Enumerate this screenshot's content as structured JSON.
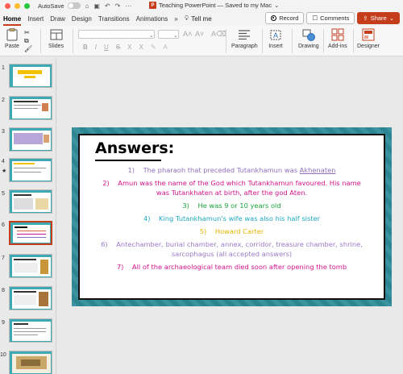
{
  "window": {
    "autosave_label": "AutoSave",
    "doc_title": "Teaching PowerPoint — Saved to my Mac",
    "doc_title_chevron": "⌄"
  },
  "tabs": [
    "Home",
    "Insert",
    "Draw",
    "Design",
    "Transitions",
    "Animations"
  ],
  "tabs_more": "»",
  "tell_me": "Tell me",
  "buttons": {
    "record": "Record",
    "comments": "Comments",
    "share": "Share"
  },
  "ribbon": {
    "paste": "Paste",
    "slides": "Slides",
    "format_buttons": [
      "B",
      "I",
      "U",
      "S",
      "X",
      "X"
    ],
    "paragraph": "Paragraph",
    "insert": "Insert",
    "drawing": "Drawing",
    "addins": "Add-ins",
    "designer": "Designer"
  },
  "thumbnails": {
    "numbers": [
      "1",
      "2",
      "3",
      "4",
      "5",
      "6",
      "7",
      "8",
      "9",
      "10"
    ],
    "star": "★",
    "selected_index": 6
  },
  "slide": {
    "title": "Answers:",
    "lines": [
      {
        "num": "1)",
        "text": "The pharaoh that preceded Tutankhamun was",
        "link": "Akhenaten"
      },
      {
        "num": "2)",
        "text": "Amun was the name of the God which Tutankhamun favoured. His name"
      },
      {
        "text": "was Tutankhaten at birth, after the god Aten."
      },
      {
        "num": "3)",
        "text": "He was 9 or 10 years old"
      },
      {
        "num": "4)",
        "text": "King Tutankhamun's wife was also his half sister"
      },
      {
        "num": "5)",
        "text": "Howard Carter"
      },
      {
        "num": "6)",
        "text": "Antechamber, burial chamber, annex, corridor, treasure chamber, shrine,"
      },
      {
        "text": "sarcophagus (all accepted answers)"
      },
      {
        "num": "7)",
        "text": "All of the archaeological team died soon after opening the tomb"
      }
    ]
  },
  "colors": {
    "accent": "#c43e1c",
    "slide_border": "#2f8c99",
    "answer_purple": "#8f6fbf",
    "answer_magenta": "#d4138b",
    "answer_green": "#19a43c",
    "answer_teal": "#1fa8c0",
    "answer_yellow": "#e6b400"
  }
}
